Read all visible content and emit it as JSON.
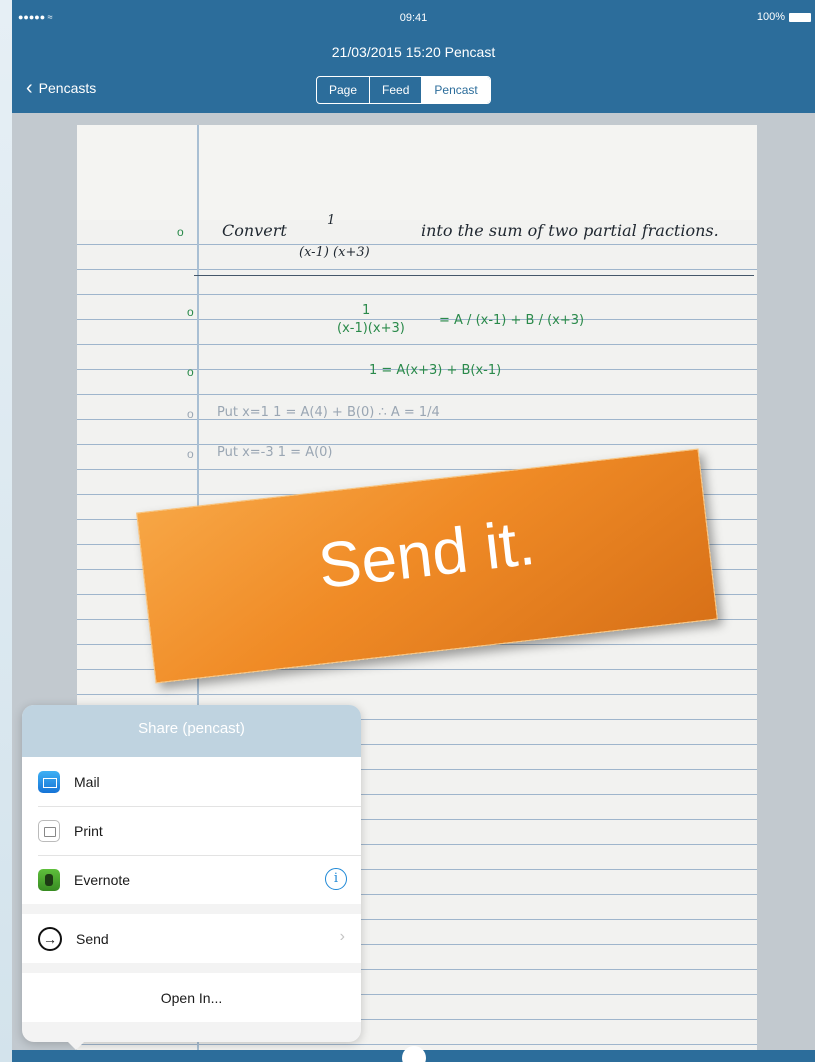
{
  "status": {
    "signal": "●●●●● ≈",
    "time": "09:41",
    "battery": "100%"
  },
  "nav": {
    "title": "21/03/2015 15:20 Pencast",
    "back_label": "Pencasts",
    "segments": [
      "Page",
      "Feed",
      "Pencast"
    ],
    "active_segment": "Pencast"
  },
  "notes": {
    "line1_prefix": "Convert",
    "line1_frac_num": "1",
    "line1_frac_den": "(x-1) (x+3)",
    "line1_suffix": "into the sum of two partial fractions.",
    "line2_lhs_num": "1",
    "line2_lhs_den": "(x-1)(x+3)",
    "line2_rhs": "=   A / (x-1)   +   B / (x+3)",
    "line3": "1   =   A(x+3)  +  B(x-1)",
    "line4": "Put  x=1        1   =  A(4) + B(0)    ∴  A = 1/4",
    "line5": "Put  x=-3       1   =  A(0)"
  },
  "banner": {
    "text": "Send it."
  },
  "share": {
    "title": "Share (pencast)",
    "items": [
      {
        "label": "Mail",
        "icon": "mail-icon"
      },
      {
        "label": "Print",
        "icon": "print-icon"
      },
      {
        "label": "Evernote",
        "icon": "evernote-icon"
      }
    ],
    "send_label": "Send",
    "open_in_label": "Open In..."
  },
  "colors": {
    "nav": "#2c6d9b",
    "banner": "#f08b26",
    "accent": "#1e88d6"
  }
}
